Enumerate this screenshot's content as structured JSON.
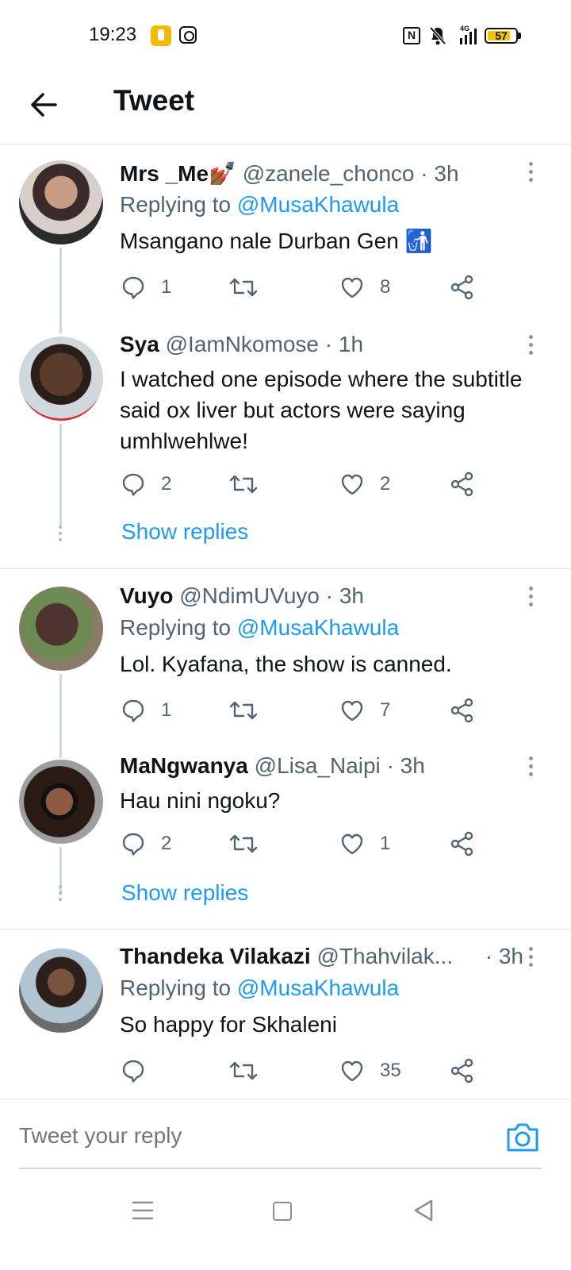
{
  "status_bar": {
    "time": "19:23",
    "network": "4G",
    "battery": "57"
  },
  "header": {
    "title": "Tweet"
  },
  "tweets": [
    {
      "name": "Mrs _Me💅🏾",
      "handle": "@zanele_chonco",
      "time": "· 3h",
      "replying_prefix": "Replying to",
      "replying_to": "@MusaKhawula",
      "text": "Msangano nale Durban Gen 🚮",
      "replies": "1",
      "retweets": "",
      "likes": "8"
    },
    {
      "name": "Sya",
      "handle": "@IamNkomose",
      "time": "· 1h",
      "text": "I watched one episode where the subtitle said ox liver but actors were saying umhlwehlwe!",
      "replies": "2",
      "retweets": "",
      "likes": "2",
      "show_replies": "Show replies"
    },
    {
      "name": "Vuyo",
      "handle": "@NdimUVuyo",
      "time": "· 3h",
      "replying_prefix": "Replying to",
      "replying_to": "@MusaKhawula",
      "text": "Lol. Kyafana, the show is canned.",
      "replies": "1",
      "retweets": "",
      "likes": "7"
    },
    {
      "name": "MaNgwanya",
      "handle": "@Lisa_Naipi",
      "time": "· 3h",
      "text": "Hau nini ngoku?",
      "replies": "2",
      "retweets": "",
      "likes": "1",
      "show_replies": "Show replies"
    },
    {
      "name": "Thandeka Vilakazi",
      "handle": "@Thahvilak...",
      "time": "· 3h",
      "replying_prefix": "Replying to",
      "replying_to": "@MusaKhawula",
      "text": "So happy for Skhaleni",
      "replies": "",
      "retweets": "",
      "likes": "35"
    }
  ],
  "reply_bar": {
    "placeholder": "Tweet your reply"
  },
  "icons": {
    "back": "arrow-left-icon",
    "more": "more-vertical-icon",
    "reply": "comment-icon",
    "retweet": "retweet-icon",
    "like": "heart-icon",
    "share": "share-icon",
    "camera": "camera-icon"
  },
  "colors": {
    "accent": "#1d9bf0",
    "text": "#0f1419",
    "secondary": "#536471"
  }
}
